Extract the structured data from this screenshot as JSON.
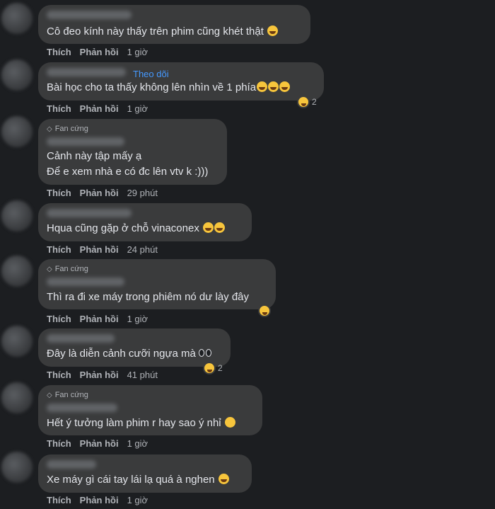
{
  "labels": {
    "like": "Thích",
    "reply": "Phản hồi",
    "fan": "Fan cứng",
    "follow": "Theo dõi"
  },
  "comments": [
    {
      "text": "Cô đeo kính này thấy trên phim cũng khét thật",
      "time": "1 giờ"
    },
    {
      "text": "Bài học cho ta thấy không lên nhìn về 1 phía",
      "time": "1 giờ",
      "reaction_count": "2"
    },
    {
      "text_line1": "Cảnh này tập mấy ạ",
      "text_line2": "Để e xem nhà e có đc lên vtv k :)))",
      "time": "29 phút"
    },
    {
      "text": "Hqua cũng gặp ở chỗ vinaconex",
      "time": "24 phút"
    },
    {
      "text": "Thì ra đi xe máy trong phiêm nó dư lày đây",
      "time": "1 giờ"
    },
    {
      "text": "Đây là diễn cảnh cưỡi ngựa mà",
      "time": "41 phút",
      "reaction_count": "2"
    },
    {
      "text": "Hết ý tưởng làm phim r hay sao ý nhỉ",
      "time": "1 giờ"
    },
    {
      "text": "Xe máy gì cái tay lái lạ quá à nghen",
      "time": "1 giờ"
    }
  ],
  "icons": {
    "fan_badge": "diamond-icon",
    "emoji": "laughing-emoji-icon"
  },
  "colors": {
    "background": "#1c1e21",
    "bubble": "#3a3b3c",
    "link": "#4599ff",
    "meta": "#b0b3b8"
  }
}
